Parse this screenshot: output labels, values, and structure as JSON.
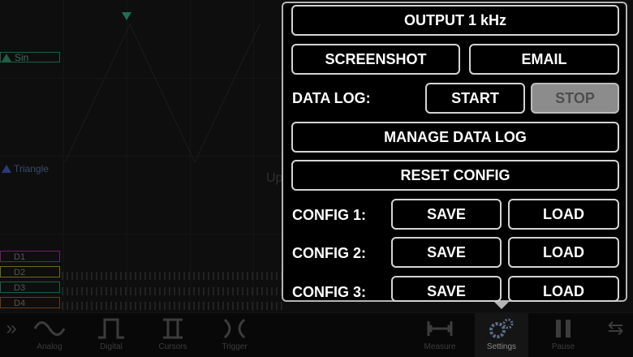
{
  "channels": {
    "sin": "Sin",
    "triangle": "Triangle",
    "digital": [
      "D1",
      "D2",
      "D3",
      "D4"
    ]
  },
  "watermark": "UpdateStar.com",
  "toolbar": {
    "items": [
      {
        "label": "Analog",
        "icon": "sine-wave-icon"
      },
      {
        "label": "Digital",
        "icon": "square-wave-icon"
      },
      {
        "label": "Cursors",
        "icon": "cursors-icon"
      },
      {
        "label": "Trigger",
        "icon": "trigger-icon"
      },
      {
        "label": "Measure",
        "icon": "measure-icon"
      },
      {
        "label": "Settings",
        "icon": "gears-icon"
      },
      {
        "label": "Pause",
        "icon": "pause-icon"
      }
    ]
  },
  "settings": {
    "output_label": "OUTPUT 1 kHz",
    "screenshot_label": "SCREENSHOT",
    "email_label": "EMAIL",
    "data_log_label": "DATA LOG:",
    "start_label": "START",
    "stop_label": "STOP",
    "manage_label": "MANAGE DATA LOG",
    "reset_label": "RESET CONFIG",
    "configs": [
      {
        "label": "CONFIG 1:",
        "save": "SAVE",
        "load": "LOAD"
      },
      {
        "label": "CONFIG 2:",
        "save": "SAVE",
        "load": "LOAD"
      },
      {
        "label": "CONFIG 3:",
        "save": "SAVE",
        "load": "LOAD"
      }
    ]
  },
  "colors": {
    "sin_channel": "#1f5d45",
    "triangle_channel": "#2c3a7a",
    "d1": "#6a1f6a",
    "d2": "#6e6a1a",
    "d3": "#1a5e4e",
    "d4": "#6a3a1a",
    "panel_border": "#b5b5b5",
    "disabled_button": "#8c8c8c"
  }
}
